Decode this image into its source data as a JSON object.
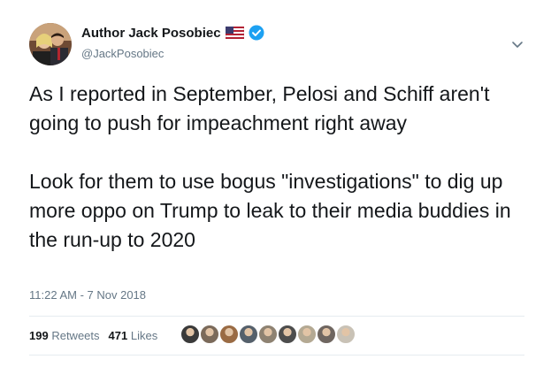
{
  "author": {
    "display_name": "Author Jack Posobiec",
    "handle": "@JackPosobiec",
    "avatar_icon": "avatar-photo",
    "flag_icon": "us-flag-icon",
    "verified_icon": "verified-badge-icon"
  },
  "tweet": {
    "text": "As I reported in September, Pelosi and Schiff aren't going to push for impeachment right away\n\nLook for them to use bogus \"investigations\" to dig up more oppo on Trump to leak to their media buddies in the run-up to 2020",
    "timestamp": "11:22 AM - 7 Nov 2018"
  },
  "stats": {
    "retweets_count": "199",
    "retweets_label": "Retweets",
    "likes_count": "471",
    "likes_label": "Likes"
  },
  "likers": [
    {
      "name": "liker-avatar-1",
      "color": "#3a3a3a"
    },
    {
      "name": "liker-avatar-2",
      "color": "#7b6a5a"
    },
    {
      "name": "liker-avatar-3",
      "color": "#9a6b44"
    },
    {
      "name": "liker-avatar-4",
      "color": "#55606b"
    },
    {
      "name": "liker-avatar-5",
      "color": "#8e8272"
    },
    {
      "name": "liker-avatar-6",
      "color": "#4d4d4d"
    },
    {
      "name": "liker-avatar-7",
      "color": "#b4a993"
    },
    {
      "name": "liker-avatar-8",
      "color": "#6f6660"
    },
    {
      "name": "liker-avatar-9",
      "color": "#c9c2b6"
    }
  ],
  "colors": {
    "text_primary": "#14171a",
    "text_secondary": "#657786",
    "divider": "#e6ecf0",
    "verified_blue": "#1da1f2"
  }
}
